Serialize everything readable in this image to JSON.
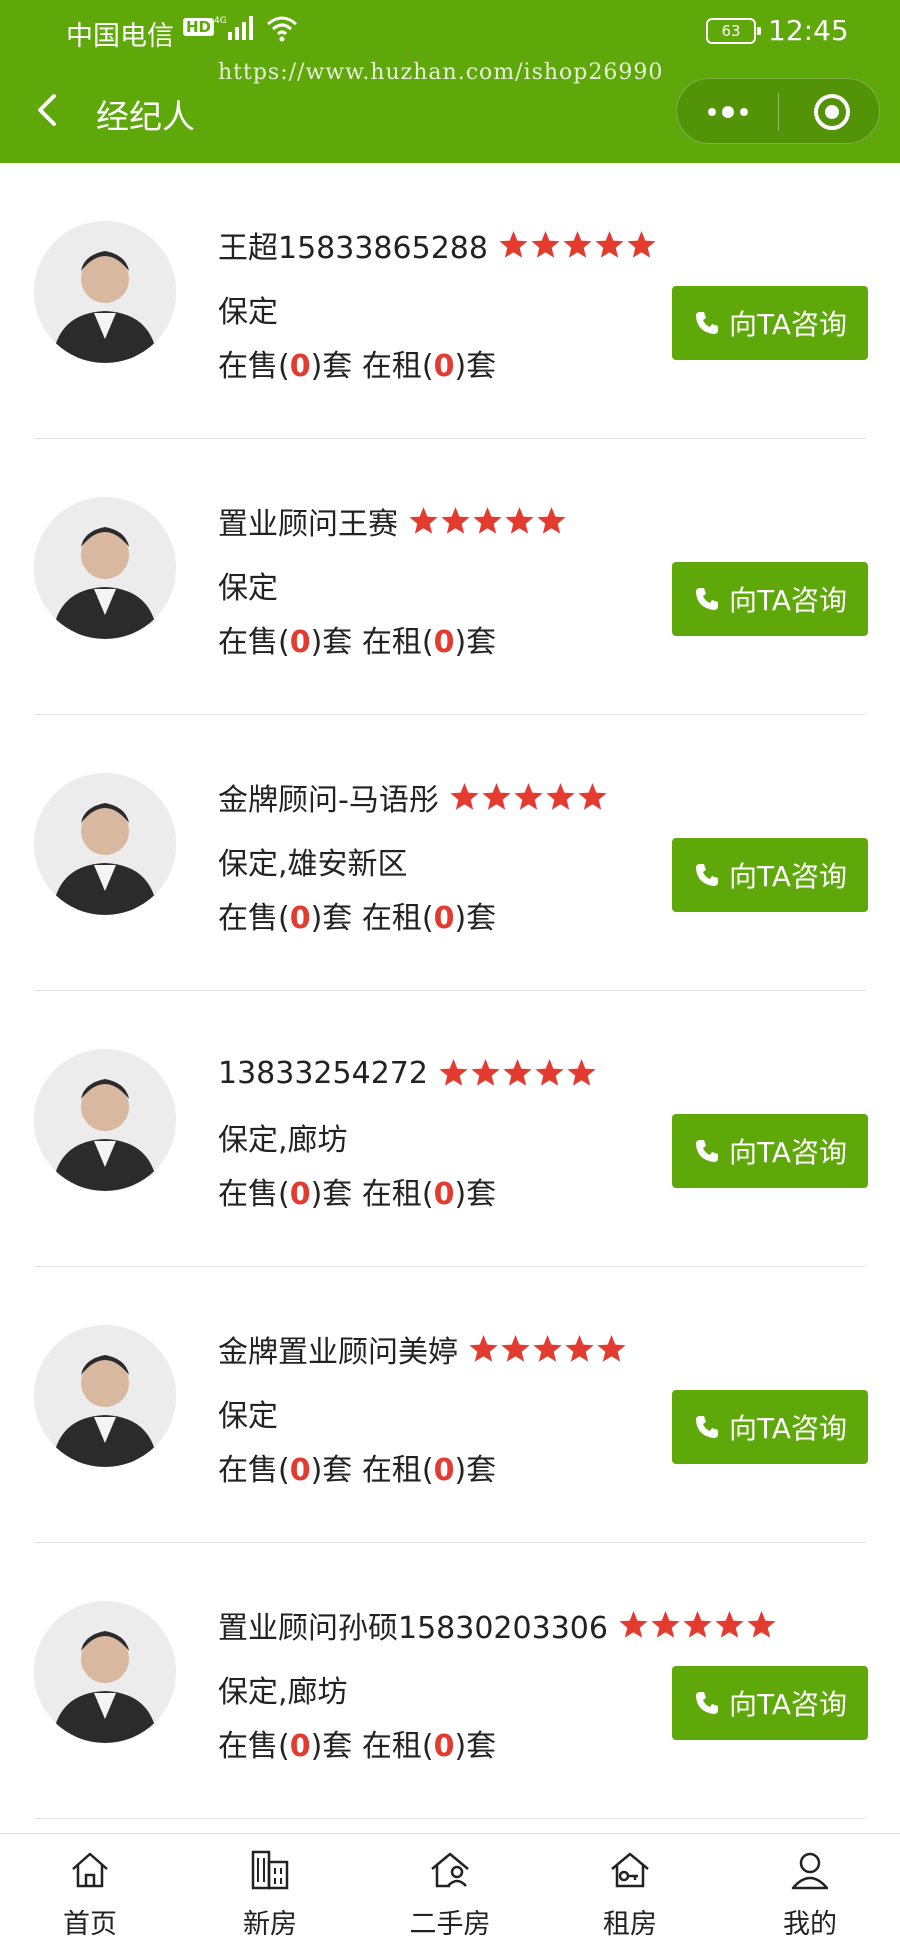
{
  "status_bar": {
    "carrier": "中国电信",
    "hd": "HD",
    "battery": "63",
    "time": "12:45"
  },
  "watermark": "https://www.huzhan.com/ishop26990",
  "header": {
    "title": "经纪人",
    "back_icon": "chevron-left-icon",
    "more_icon": "more-dots-icon",
    "close_icon": "target-close-icon"
  },
  "colors": {
    "primary": "#5fa80a",
    "star": "#e33b30",
    "count": "#e33b30"
  },
  "consult_label": "向TA咨询",
  "agents": [
    {
      "name": "王超15833865288",
      "rating": 5,
      "area": "保定",
      "for_sale_prefix": "在售(",
      "for_sale": "0",
      "for_sale_suffix": ")套",
      "for_rent_prefix": "在租(",
      "for_rent": "0",
      "for_rent_suffix": ")套"
    },
    {
      "name": "置业顾问王赛",
      "rating": 5,
      "area": "保定",
      "for_sale_prefix": "在售(",
      "for_sale": "0",
      "for_sale_suffix": ")套",
      "for_rent_prefix": "在租(",
      "for_rent": "0",
      "for_rent_suffix": ")套"
    },
    {
      "name": "金牌顾问-马语彤",
      "rating": 5,
      "area": "保定,雄安新区",
      "for_sale_prefix": "在售(",
      "for_sale": "0",
      "for_sale_suffix": ")套",
      "for_rent_prefix": "在租(",
      "for_rent": "0",
      "for_rent_suffix": ")套"
    },
    {
      "name": "13833254272",
      "rating": 5,
      "area": "保定,廊坊",
      "for_sale_prefix": "在售(",
      "for_sale": "0",
      "for_sale_suffix": ")套",
      "for_rent_prefix": "在租(",
      "for_rent": "0",
      "for_rent_suffix": ")套"
    },
    {
      "name": "金牌置业顾问美婷",
      "rating": 5,
      "area": "保定",
      "for_sale_prefix": "在售(",
      "for_sale": "0",
      "for_sale_suffix": ")套",
      "for_rent_prefix": "在租(",
      "for_rent": "0",
      "for_rent_suffix": ")套"
    },
    {
      "name": "置业顾问孙硕15830203306",
      "rating": 5,
      "area": "保定,廊坊",
      "for_sale_prefix": "在售(",
      "for_sale": "0",
      "for_sale_suffix": ")套",
      "for_rent_prefix": "在租(",
      "for_rent": "0",
      "for_rent_suffix": ")套"
    }
  ],
  "tabbar": [
    {
      "label": "首页",
      "icon": "home-icon"
    },
    {
      "label": "新房",
      "icon": "building-icon"
    },
    {
      "label": "二手房",
      "icon": "house-person-icon"
    },
    {
      "label": "租房",
      "icon": "house-key-icon"
    },
    {
      "label": "我的",
      "icon": "user-icon"
    }
  ]
}
